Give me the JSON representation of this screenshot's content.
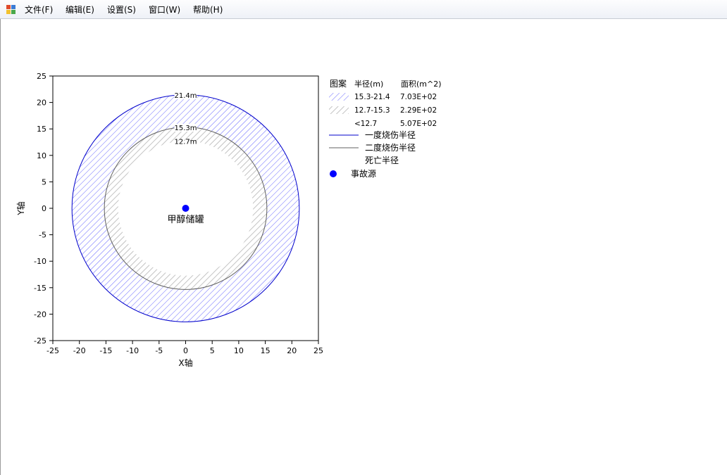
{
  "menu": {
    "items": [
      {
        "label": "文件(F)",
        "underline": "F"
      },
      {
        "label": "编辑(E)",
        "underline": "E"
      },
      {
        "label": "设置(S)",
        "underline": "S"
      },
      {
        "label": "窗口(W)",
        "underline": "W"
      },
      {
        "label": "帮助(H)",
        "underline": "H"
      }
    ]
  },
  "icons": {
    "app": "app-window-icon",
    "source": "accident-source-marker-icon"
  },
  "colors": {
    "outer_ring": "#0000cc",
    "outer_hatch": "#6666ff",
    "inner_ring": "#606060",
    "inner_hatch": "#b4b4b4",
    "source_point": "#0000ff"
  },
  "chart_data": {
    "type": "scatter",
    "xlabel": "X轴",
    "ylabel": "Y轴",
    "xlim": [
      -25,
      25
    ],
    "ylim": [
      -25,
      25
    ],
    "xticks": [
      -25,
      -20,
      -15,
      -10,
      -5,
      0,
      5,
      10,
      15,
      20,
      25
    ],
    "yticks": [
      -25,
      -20,
      -15,
      -10,
      -5,
      0,
      5,
      10,
      15,
      20,
      25
    ],
    "grid": false,
    "legend_position": "right",
    "circles": [
      {
        "radius": 21.4,
        "label": "21.4m",
        "style": "blue-hatch"
      },
      {
        "radius": 15.3,
        "label": "15.3m",
        "style": "gray-hatch"
      },
      {
        "radius": 12.7,
        "label": "12.7m",
        "style": "none"
      }
    ],
    "source": {
      "x": 0,
      "y": 0,
      "label": "甲醇储罐"
    },
    "legend": {
      "headers": {
        "pattern": "图案",
        "radius": "半径(m)",
        "area": "面积(m^2)"
      },
      "bands": [
        {
          "range": "15.3-21.4",
          "area": "7.03E+02",
          "pattern": "blue-hatch"
        },
        {
          "range": "12.7-15.3",
          "area": "2.29E+02",
          "pattern": "gray-hatch"
        },
        {
          "range": "<12.7",
          "area": "5.07E+02",
          "pattern": "none"
        }
      ],
      "lines": [
        {
          "label": "一度烧伤半径",
          "style": "blue-line"
        },
        {
          "label": "二度烧伤半径",
          "style": "gray-line"
        },
        {
          "label": "死亡半径",
          "style": "none"
        }
      ],
      "marker": {
        "label": "事故源"
      }
    }
  }
}
